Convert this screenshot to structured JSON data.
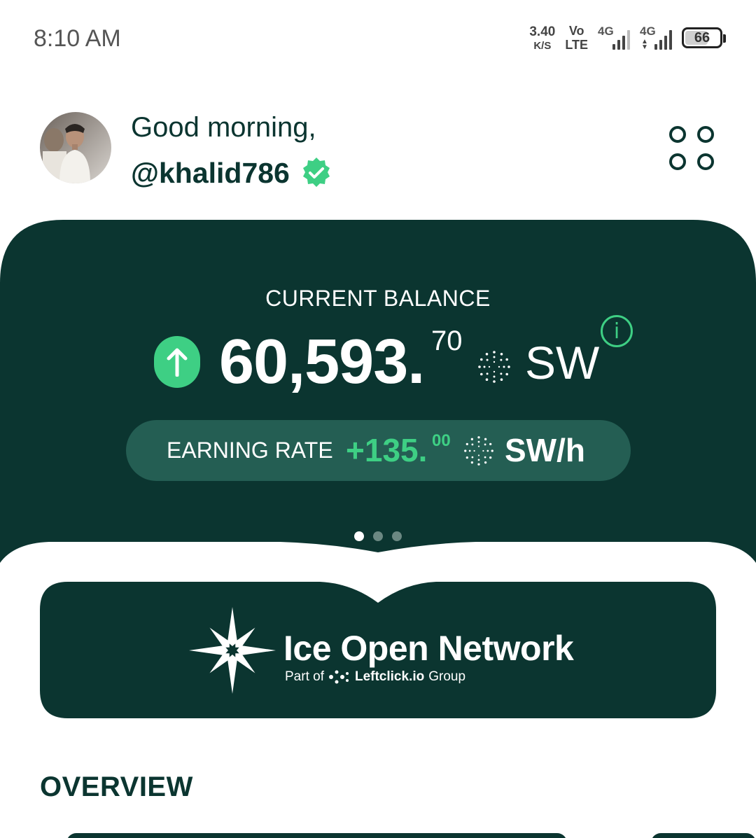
{
  "status_bar": {
    "time": "8:10 AM",
    "speed_value": "3.40",
    "speed_unit": "K/S",
    "volte_line1": "Vo",
    "volte_line2": "LTE",
    "sim1_type": "4G",
    "sim2_type": "4G",
    "battery": "66"
  },
  "header": {
    "greeting": "Good morning,",
    "username": "@khalid786",
    "avatar_alt": "profile photo",
    "menu_icon": "grid-circles-icon",
    "verified_icon": "verified-badge-icon"
  },
  "balance": {
    "label": "CURRENT BALANCE",
    "amount_int": "60,593.",
    "amount_dec": "70",
    "currency": "SW",
    "trend_icon": "arrow-up-icon",
    "info_icon": "info-icon",
    "info_glyph": "i"
  },
  "earning": {
    "label": "EARNING RATE",
    "value_int": "+135.",
    "value_dec": "00",
    "unit": "SW/h"
  },
  "carousel": {
    "page_count": 3,
    "active_index": 0
  },
  "banner": {
    "title": "Ice Open Network",
    "sub_prefix": "Part of",
    "sub_brand": "Leftclick.io",
    "sub_suffix": "Group"
  },
  "section": {
    "overview_title": "OVERVIEW"
  },
  "colors": {
    "primary_dark": "#0b3530",
    "pill": "#245e53",
    "accent_green": "#3ecf84",
    "background": "#ffffff"
  }
}
